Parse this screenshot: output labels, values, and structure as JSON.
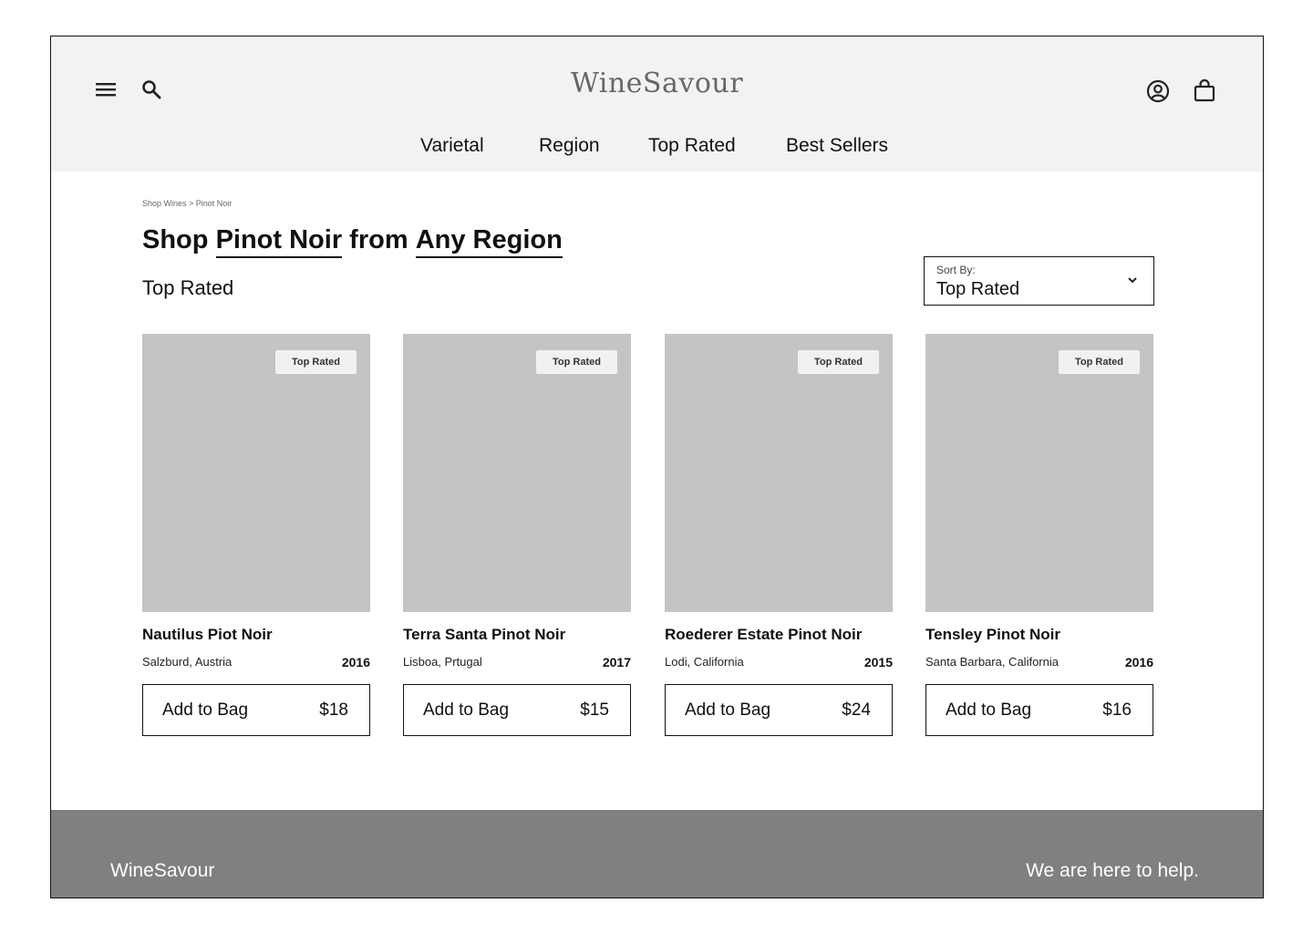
{
  "header": {
    "logo": "WineSavour",
    "icons": [
      "menu-icon",
      "search-icon",
      "account-icon",
      "bag-icon"
    ],
    "nav": [
      "Varietal",
      "Region",
      "Top Rated",
      "Best Sellers"
    ]
  },
  "breadcrumb": "Shop Wines > Pinot Noir",
  "heading": {
    "prefix": "Shop",
    "varietal": "Pinot Noir",
    "middle": "from",
    "region": "Any Region"
  },
  "section_title": "Top Rated",
  "sort": {
    "label": "Sort By:",
    "value": "Top Rated"
  },
  "products": [
    {
      "badge": "Top Rated",
      "name": "Nautilus Piot Noir",
      "region": "Salzburd, Austria",
      "year": "2016",
      "button": "Add to Bag",
      "price": "$18"
    },
    {
      "badge": "Top Rated",
      "name": "Terra Santa Pinot Noir",
      "region": "Lisboa, Prtugal",
      "year": "2017",
      "button": "Add to Bag",
      "price": "$15"
    },
    {
      "badge": "Top Rated",
      "name": "Roederer Estate Pinot Noir",
      "region": "Lodi, California",
      "year": "2015",
      "button": "Add to Bag",
      "price": "$24"
    },
    {
      "badge": "Top Rated",
      "name": "Tensley Pinot Noir",
      "region": "Santa Barbara, California",
      "year": "2016",
      "button": "Add to Bag",
      "price": "$16"
    }
  ],
  "footer": {
    "brand": "WineSavour",
    "help": "We are here to help."
  },
  "colors": {
    "header_bg": "#f2f2f2",
    "image_placeholder": "#c4c4c4",
    "footer_bg": "#808080"
  }
}
